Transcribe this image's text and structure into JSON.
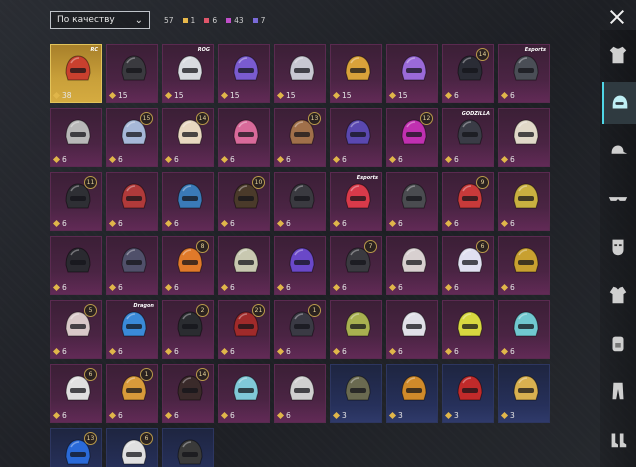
{
  "sort": {
    "selected": "По качеству"
  },
  "counts": [
    {
      "value": "57",
      "color": "#9aa0a6"
    },
    {
      "value": "1",
      "color": "#e8b84a"
    },
    {
      "value": "6",
      "color": "#e0566a"
    },
    {
      "value": "43",
      "color": "#c04fc9"
    },
    {
      "value": "7",
      "color": "#7a6ad8"
    }
  ],
  "colors": {
    "accent": "#4fd6e6",
    "legendary": "#d5ab40",
    "epic": "#612a56",
    "rare": "#2f3a6a"
  },
  "items": [
    {
      "tier": "gold",
      "qty": "38",
      "helm": "#c9402e",
      "badge": "",
      "brand": "RC"
    },
    {
      "tier": "purple",
      "qty": "15",
      "helm": "#3a3a3f",
      "badge": "",
      "brand": ""
    },
    {
      "tier": "purple",
      "qty": "15",
      "helm": "#d8dbe0",
      "badge": "",
      "brand": "ROG"
    },
    {
      "tier": "purple",
      "qty": "15",
      "helm": "#7a5bd0",
      "badge": "",
      "brand": ""
    },
    {
      "tier": "purple",
      "qty": "15",
      "helm": "#c8c8d2",
      "badge": "",
      "brand": ""
    },
    {
      "tier": "purple",
      "qty": "15",
      "helm": "#d9a23a",
      "badge": "",
      "brand": ""
    },
    {
      "tier": "purple",
      "qty": "15",
      "helm": "#9a6ad8",
      "badge": "",
      "brand": ""
    },
    {
      "tier": "purple",
      "qty": "6",
      "helm": "#2a2c35",
      "badge": "14",
      "brand": ""
    },
    {
      "tier": "purple",
      "qty": "6",
      "helm": "#4a4e56",
      "badge": "",
      "brand": "Esports"
    },
    {
      "tier": "purple",
      "qty": "6",
      "helm": "#b8b8b8",
      "badge": "",
      "brand": ""
    },
    {
      "tier": "purple",
      "qty": "6",
      "helm": "#a6b8d8",
      "badge": "15",
      "brand": ""
    },
    {
      "tier": "purple",
      "qty": "6",
      "helm": "#e8d8c0",
      "badge": "14",
      "brand": ""
    },
    {
      "tier": "purple",
      "qty": "6",
      "helm": "#d86a9a",
      "badge": "",
      "brand": ""
    },
    {
      "tier": "purple",
      "qty": "6",
      "helm": "#a0704a",
      "badge": "13",
      "brand": ""
    },
    {
      "tier": "purple",
      "qty": "6",
      "helm": "#5a48b0",
      "badge": "",
      "brand": ""
    },
    {
      "tier": "purple",
      "qty": "6",
      "helm": "#c030b0",
      "badge": "12",
      "brand": ""
    },
    {
      "tier": "purple",
      "qty": "6",
      "helm": "#3a3c46",
      "badge": "",
      "brand": "GODZILLA"
    },
    {
      "tier": "purple",
      "qty": "6",
      "helm": "#e0d8c8",
      "badge": "",
      "brand": ""
    },
    {
      "tier": "purple",
      "qty": "6",
      "helm": "#2e2f34",
      "badge": "11",
      "brand": ""
    },
    {
      "tier": "purple",
      "qty": "6",
      "helm": "#b03a3a",
      "badge": "",
      "brand": ""
    },
    {
      "tier": "purple",
      "qty": "6",
      "helm": "#3a7ab8",
      "badge": "",
      "brand": ""
    },
    {
      "tier": "purple",
      "qty": "6",
      "helm": "#4a3a2a",
      "badge": "10",
      "brand": ""
    },
    {
      "tier": "purple",
      "qty": "6",
      "helm": "#3a3a40",
      "badge": "",
      "brand": ""
    },
    {
      "tier": "purple",
      "qty": "6",
      "helm": "#d83a4a",
      "badge": "",
      "brand": "Esports"
    },
    {
      "tier": "purple",
      "qty": "6",
      "helm": "#4a4c50",
      "badge": "",
      "brand": ""
    },
    {
      "tier": "purple",
      "qty": "6",
      "helm": "#c83a3a",
      "badge": "9",
      "brand": ""
    },
    {
      "tier": "purple",
      "qty": "6",
      "helm": "#c8b040",
      "badge": "",
      "brand": ""
    },
    {
      "tier": "purple",
      "qty": "6",
      "helm": "#2a2a30",
      "badge": "",
      "brand": ""
    },
    {
      "tier": "purple",
      "qty": "6",
      "helm": "#50506a",
      "badge": "",
      "brand": ""
    },
    {
      "tier": "purple",
      "qty": "6",
      "helm": "#e07a2a",
      "badge": "8",
      "brand": ""
    },
    {
      "tier": "purple",
      "qty": "6",
      "helm": "#c8c8b0",
      "badge": "",
      "brand": ""
    },
    {
      "tier": "purple",
      "qty": "6",
      "helm": "#6a48c8",
      "badge": "",
      "brand": ""
    },
    {
      "tier": "purple",
      "qty": "6",
      "helm": "#3a3a40",
      "badge": "7",
      "brand": ""
    },
    {
      "tier": "purple",
      "qty": "6",
      "helm": "#d8d0d0",
      "badge": "",
      "brand": ""
    },
    {
      "tier": "purple",
      "qty": "6",
      "helm": "#e0e0f0",
      "badge": "6",
      "brand": ""
    },
    {
      "tier": "purple",
      "qty": "6",
      "helm": "#c8a030",
      "badge": "",
      "brand": ""
    },
    {
      "tier": "purple",
      "qty": "6",
      "helm": "#d8c8c8",
      "badge": "5",
      "brand": ""
    },
    {
      "tier": "purple",
      "qty": "6",
      "helm": "#3a8ad8",
      "badge": "",
      "brand": "Dragon"
    },
    {
      "tier": "purple",
      "qty": "6",
      "helm": "#2a2c30",
      "badge": "2",
      "brand": ""
    },
    {
      "tier": "purple",
      "qty": "6",
      "helm": "#a02a2a",
      "badge": "21",
      "brand": ""
    },
    {
      "tier": "purple",
      "qty": "6",
      "helm": "#3a3a44",
      "badge": "1",
      "brand": ""
    },
    {
      "tier": "purple",
      "qty": "6",
      "helm": "#a8b050",
      "badge": "",
      "brand": ""
    },
    {
      "tier": "purple",
      "qty": "6",
      "helm": "#e0e0e8",
      "badge": "",
      "brand": ""
    },
    {
      "tier": "purple",
      "qty": "6",
      "helm": "#d8d840",
      "badge": "",
      "brand": ""
    },
    {
      "tier": "purple",
      "qty": "6",
      "helm": "#70c8d0",
      "badge": "",
      "brand": ""
    },
    {
      "tier": "purple",
      "qty": "6",
      "helm": "#e0e0e0",
      "badge": "6",
      "brand": ""
    },
    {
      "tier": "purple",
      "qty": "6",
      "helm": "#d89a3a",
      "badge": "1",
      "brand": ""
    },
    {
      "tier": "purple",
      "qty": "6",
      "helm": "#3a2a2a",
      "badge": "14",
      "brand": ""
    },
    {
      "tier": "purple",
      "qty": "6",
      "helm": "#80c8d8",
      "badge": "",
      "brand": ""
    },
    {
      "tier": "purple",
      "qty": "6",
      "helm": "#d0d0d0",
      "badge": "",
      "brand": ""
    },
    {
      "tier": "blue",
      "qty": "3",
      "helm": "#6a6a50",
      "badge": "",
      "brand": ""
    },
    {
      "tier": "blue",
      "qty": "3",
      "helm": "#d08a2a",
      "badge": "",
      "brand": ""
    },
    {
      "tier": "blue",
      "qty": "3",
      "helm": "#c02a2a",
      "badge": "",
      "brand": ""
    },
    {
      "tier": "blue",
      "qty": "3",
      "helm": "#d8b050",
      "badge": "",
      "brand": ""
    },
    {
      "tier": "blue",
      "qty": "",
      "helm": "#2a6ad8",
      "badge": "13",
      "brand": ""
    },
    {
      "tier": "blue",
      "qty": "",
      "helm": "#e0e0e0",
      "badge": "6",
      "brand": ""
    },
    {
      "tier": "blue",
      "qty": "",
      "helm": "#3a3a3a",
      "badge": "",
      "brand": ""
    }
  ],
  "categories": [
    {
      "name": "outfit"
    },
    {
      "name": "helmet"
    },
    {
      "name": "hat"
    },
    {
      "name": "eyewear"
    },
    {
      "name": "mask"
    },
    {
      "name": "jacket"
    },
    {
      "name": "backpack"
    },
    {
      "name": "pants"
    },
    {
      "name": "shoes"
    }
  ]
}
